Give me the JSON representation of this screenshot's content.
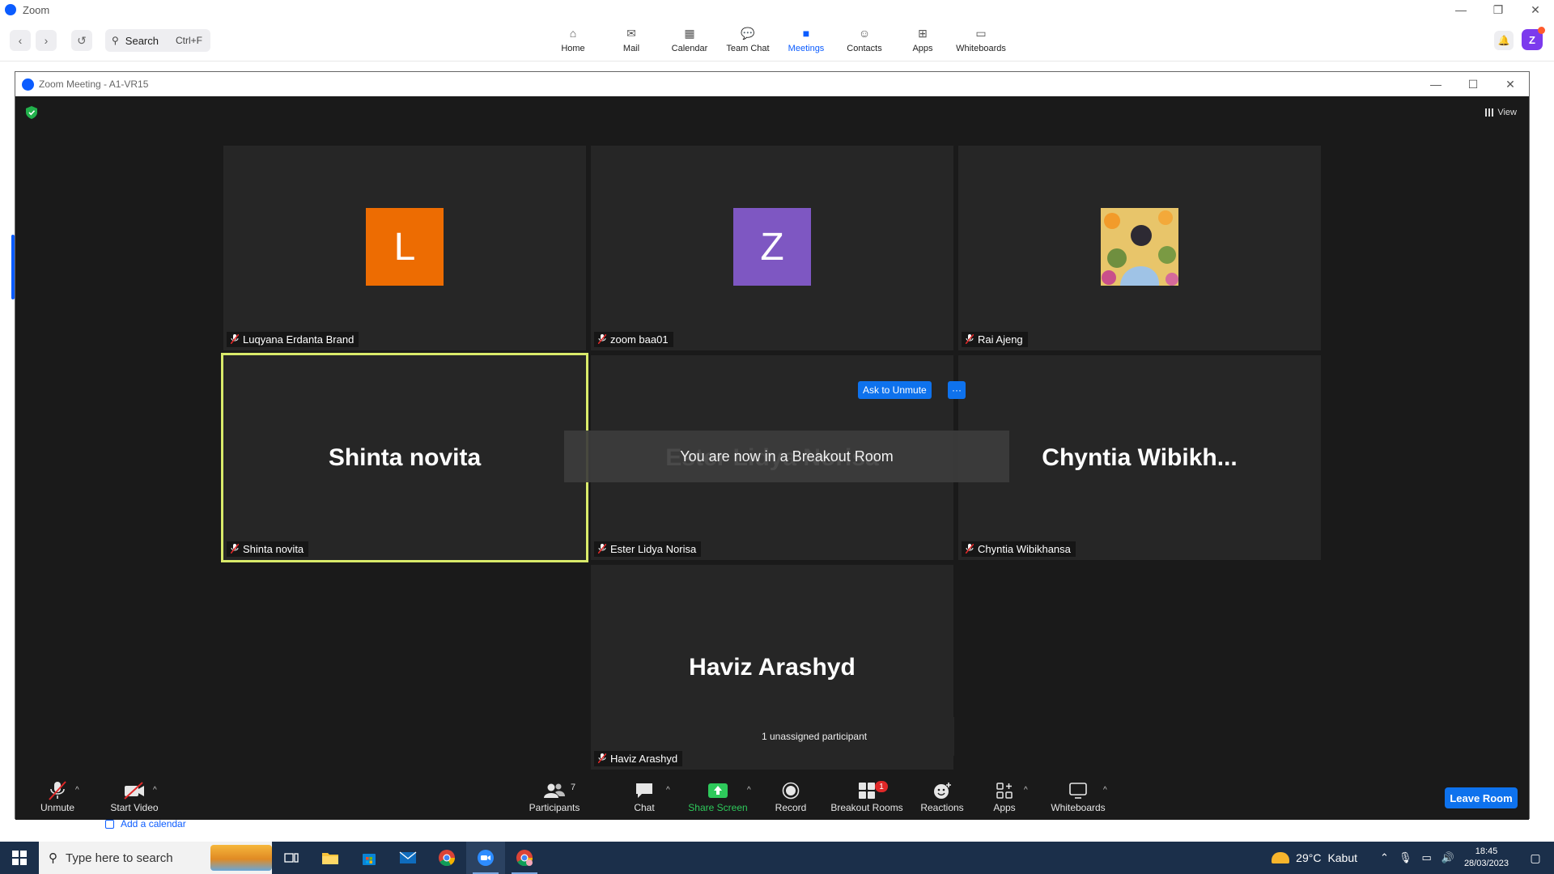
{
  "app": {
    "title": "Zoom",
    "window_controls": {
      "minimize": "—",
      "restore": "❐",
      "close": "✕"
    },
    "search": {
      "label": "Search",
      "shortcut": "Ctrl+F"
    },
    "tabs": [
      {
        "label": "Home",
        "icon": "home-icon"
      },
      {
        "label": "Mail",
        "icon": "mail-icon"
      },
      {
        "label": "Calendar",
        "icon": "calendar-icon"
      },
      {
        "label": "Team Chat",
        "icon": "chat-icon"
      },
      {
        "label": "Meetings",
        "icon": "video-icon",
        "active": true
      },
      {
        "label": "Contacts",
        "icon": "contacts-icon"
      },
      {
        "label": "Apps",
        "icon": "apps-icon"
      },
      {
        "label": "Whiteboards",
        "icon": "whiteboard-icon"
      }
    ],
    "avatar_letter": "Z",
    "add_calendar": "Add a calendar"
  },
  "meeting": {
    "title": "Zoom Meeting - A1-VR15",
    "view_label": "View",
    "participants": [
      {
        "name": "Luqyana Erdanta Brand",
        "display": "L",
        "avatar_color": "#ed6c02",
        "muted": true
      },
      {
        "name": "zoom baa01",
        "display": "Z",
        "avatar_color": "#7e57c2",
        "muted": true
      },
      {
        "name": "Rai Ajeng",
        "display": "",
        "avatar": "photo",
        "muted": true
      },
      {
        "name": "Shinta novita",
        "display": "Shinta novita",
        "muted": true,
        "active_speaker": true
      },
      {
        "name": "Ester Lidya Norisa",
        "display": "Ester Lidya Norisa",
        "muted": true
      },
      {
        "name": "Chyntia Wibikhansa",
        "display": "Chyntia  Wibikh...",
        "muted": true
      },
      {
        "name": "Haviz Arashyd",
        "display": "Haviz Arashyd",
        "muted": true
      }
    ],
    "ask_to_unmute": "Ask to Unmute",
    "more": "···",
    "toast": "You are now in a Breakout Room",
    "unassigned_tooltip": "1 unassigned participant",
    "controls": {
      "unmute": "Unmute",
      "start_video": "Start Video",
      "participants": "Participants",
      "participants_count": "7",
      "chat": "Chat",
      "share_screen": "Share Screen",
      "record": "Record",
      "breakout_rooms": "Breakout Rooms",
      "breakout_badge": "1",
      "reactions": "Reactions",
      "apps": "Apps",
      "whiteboards": "Whiteboards",
      "leave_room": "Leave Room"
    },
    "colors": {
      "accent": "#0e72ed",
      "speaker_border": "#d9ea6a",
      "share_green": "#2ec95b",
      "muted_red": "#e02828"
    }
  },
  "taskbar": {
    "search_placeholder": "Type here to search",
    "apps": [
      "task-view-icon",
      "file-explorer-icon",
      "microsoft-store-icon",
      "mail-icon",
      "chrome-icon",
      "zoom-icon",
      "chrome-profile-icon"
    ],
    "weather": {
      "temp": "29°C",
      "condition": "Kabut"
    },
    "time": "18:45",
    "date": "28/03/2023"
  }
}
